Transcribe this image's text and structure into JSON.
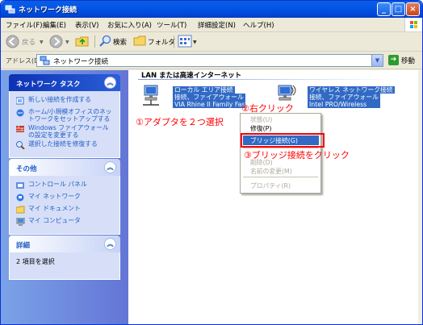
{
  "window": {
    "title": "ネットワーク接続",
    "min_symbol": "_",
    "max_symbol": "□",
    "close_symbol": "×"
  },
  "menu": {
    "items": [
      "ファイル(F)",
      "編集(E)",
      "表示(V)",
      "お気に入り(A)",
      "ツール(T)",
      "詳細設定(N)",
      "ヘルプ(H)"
    ]
  },
  "toolbar": {
    "back_label": "戻る",
    "search_label": "検索",
    "folders_label": "フォルダ"
  },
  "address": {
    "label": "アドレス(D)",
    "value": "ネットワーク接続",
    "go_label": "移動"
  },
  "taskpane": {
    "network_tasks": {
      "title": "ネットワーク タスク",
      "items": [
        "新しい接続を作成する",
        "ホーム/小規模オフィスのネットワークをセットアップする",
        "Windows ファイアウォールの設定を変更する",
        "選択した接続を修復する"
      ]
    },
    "other": {
      "title": "その他",
      "items": [
        "コントロール パネル",
        "マイ ネットワーク",
        "マイ ドキュメント",
        "マイ コンピュータ"
      ]
    },
    "details": {
      "title": "詳細",
      "text": "2 項目を選択"
    }
  },
  "main": {
    "group_title": "LAN または高速インターネット",
    "connections": [
      {
        "name": "ローカル エリア接続",
        "status": "接続、ファイアウォール",
        "device": "VIA Rhine II Family Fast"
      },
      {
        "name": "ワイヤレス ネットワーク接続",
        "status": "接続、ファイアウォール",
        "device": "Intel PRO/Wireless"
      }
    ]
  },
  "context_menu": {
    "items": [
      {
        "label": "状態(U)",
        "disabled": true
      },
      {
        "label": "修復(P)",
        "disabled": false
      },
      {
        "label": "ブリッジ接続(G)",
        "highlighted": true
      },
      {
        "label": "削除(D)",
        "disabled": true
      },
      {
        "label": "名前の変更(M)",
        "disabled": true
      },
      {
        "label": "プロパティ(R)",
        "disabled": true
      }
    ]
  },
  "annotations": {
    "step1": "①アダプタを２つ選択",
    "step2": "②右クリック",
    "step3": "③ブリッジ接続をクリック"
  },
  "colors": {
    "title_blue": "#0054e3",
    "selection": "#316ac5",
    "annotation_red": "#ff0000",
    "link_blue": "#215dc6"
  }
}
